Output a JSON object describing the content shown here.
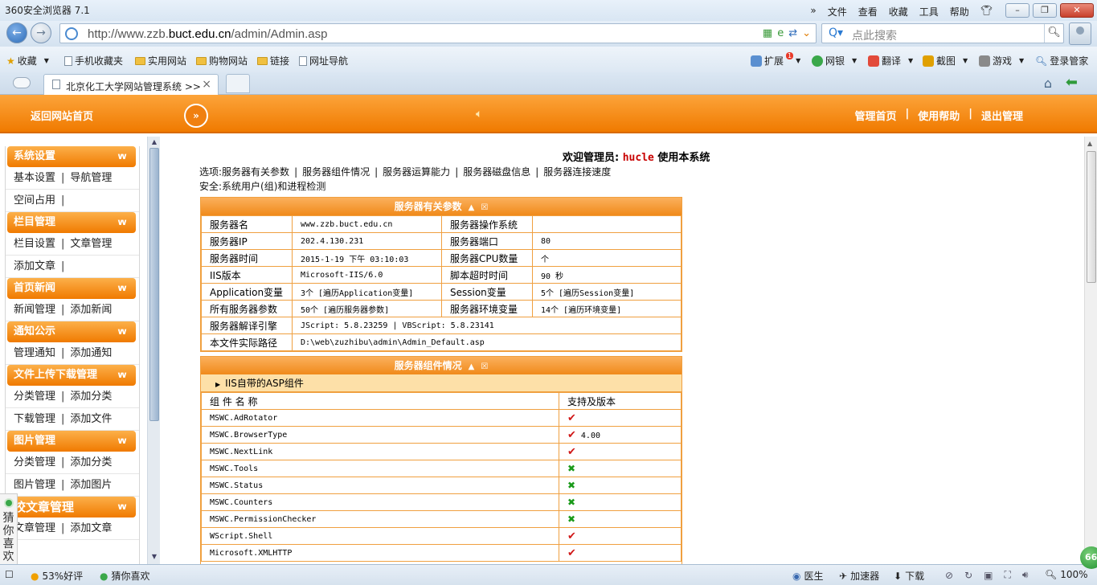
{
  "browser": {
    "app_title": "360安全浏览器 7.1",
    "menus": [
      "»",
      "文件",
      "查看",
      "收藏",
      "工具",
      "帮助"
    ],
    "url_prefix": "http://www.zzb.",
    "url_domain": "buct.edu.cn",
    "url_path": "/admin/Admin.asp",
    "search_placeholder": "点此搜索",
    "favorites": [
      {
        "label": "收藏",
        "icon": "star-add-icon"
      },
      {
        "label": "手机收藏夹",
        "icon": "phone-icon"
      },
      {
        "label": "实用网站",
        "icon": "folder-icon"
      },
      {
        "label": "购物网站",
        "icon": "folder-icon"
      },
      {
        "label": "链接",
        "icon": "folder-icon"
      },
      {
        "label": "网址导航",
        "icon": "page-icon"
      }
    ],
    "tools": [
      {
        "label": "扩展",
        "badge": "1"
      },
      {
        "label": "网银"
      },
      {
        "label": "翻译"
      },
      {
        "label": "截图"
      },
      {
        "label": "游戏"
      },
      {
        "label": "登录管家"
      }
    ],
    "tab_title": "北京化工大学网站管理系统 >>",
    "tab_close": "×"
  },
  "header": {
    "back_home": "返回网站首页",
    "toggle": "»",
    "links": [
      "管理首页",
      "使用帮助",
      "退出管理"
    ],
    "sep": "|"
  },
  "sidebar": {
    "sections": [
      {
        "title": "系统设置",
        "rows": [
          [
            "基本设置",
            "导航管理"
          ],
          [
            "空间占用",
            ""
          ]
        ]
      },
      {
        "title": "栏目管理",
        "rows": [
          [
            "栏目设置",
            "文章管理"
          ],
          [
            "添加文章",
            ""
          ]
        ]
      },
      {
        "title": "首页新闻",
        "rows": [
          [
            "新闻管理",
            "添加新闻"
          ]
        ]
      },
      {
        "title": "通知公示",
        "rows": [
          [
            "管理通知",
            "添加通知"
          ]
        ]
      },
      {
        "title": "文件上传下载管理",
        "rows": [
          [
            "分类管理",
            "添加分类"
          ],
          [
            "下载管理",
            "添加文件"
          ]
        ]
      },
      {
        "title": "图片管理",
        "rows": [
          [
            "分类管理",
            "添加分类"
          ],
          [
            "图片管理",
            "添加图片"
          ]
        ]
      },
      {
        "title": "校文章管理",
        "rows": [
          [
            "文章管理",
            "添加文章"
          ]
        ]
      }
    ]
  },
  "main": {
    "welcome_pre": "欢迎管理员:",
    "username": "hucle",
    "welcome_post": "使用本系统",
    "options_label": "选项:",
    "options": [
      "服务器有关参数",
      "服务器组件情况",
      "服务器运算能力",
      "服务器磁盘信息",
      "服务器连接速度"
    ],
    "security_label": "安全:",
    "security_link": "系统用户(组)和进程检测",
    "params_title": "服务器有关参数",
    "params": [
      [
        "服务器名",
        "www.zzb.buct.edu.cn",
        "服务器操作系统",
        ""
      ],
      [
        "服务器IP",
        "202.4.130.231",
        "服务器端口",
        "80"
      ],
      [
        "服务器时间",
        "2015-1-19 下午 03:10:03",
        "服务器CPU数量",
        "个"
      ],
      [
        "IIS版本",
        "Microsoft-IIS/6.0",
        "脚本超时时间",
        "90 秒"
      ],
      [
        "Application变量",
        "3个 [遍历Application变量]",
        "Session变量",
        "5个 [遍历Session变量]"
      ],
      [
        "所有服务器参数",
        "50个 [遍历服务器参数]",
        "服务器环境变量",
        "14个 [遍历环境变量]"
      ]
    ],
    "engine_label": "服务器解译引擎",
    "engine_value": "JScript: 5.8.23259 | VBScript: 5.8.23141",
    "path_label": "本文件实际路径",
    "path_value": "D:\\web\\zuzhibu\\admin\\Admin_Default.asp",
    "comp_title": "服务器组件情况",
    "comp_sub": "IIS自带的ASP组件",
    "comp_col1": "组 件 名 称",
    "comp_col2": "支持及版本",
    "components": [
      {
        "name": "MSWC.AdRotator",
        "ok": true,
        "ver": ""
      },
      {
        "name": "MSWC.BrowserType",
        "ok": true,
        "ver": "4.00"
      },
      {
        "name": "MSWC.NextLink",
        "ok": true,
        "ver": ""
      },
      {
        "name": "MSWC.Tools",
        "ok": false,
        "ver": ""
      },
      {
        "name": "MSWC.Status",
        "ok": false,
        "ver": ""
      },
      {
        "name": "MSWC.Counters",
        "ok": false,
        "ver": ""
      },
      {
        "name": "MSWC.PermissionChecker",
        "ok": false,
        "ver": ""
      },
      {
        "name": "WScript.Shell",
        "ok": true,
        "ver": ""
      },
      {
        "name": "Microsoft.XMLHTTP",
        "ok": true,
        "ver": ""
      }
    ]
  },
  "guess": {
    "text": "猜你喜欢"
  },
  "status": {
    "rating": "53%好评",
    "guess": "猜你喜欢",
    "right": [
      "医生",
      "加速器",
      "下载"
    ],
    "zoom": "100%",
    "ball": "66"
  },
  "colors": {
    "accent": "#f07a00",
    "ok": "#d01818",
    "no": "#1a9a1a"
  }
}
